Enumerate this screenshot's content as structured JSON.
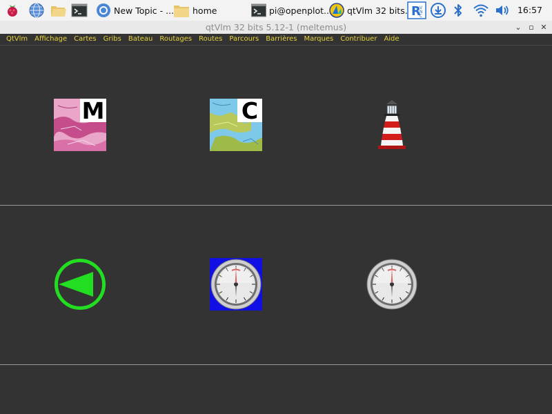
{
  "taskbar": {
    "tasks": [
      {
        "label": "New Topic - ..."
      },
      {
        "label": "home"
      },
      {
        "label": "pi@openplot..."
      },
      {
        "label": "qtVlm 32 bits..."
      }
    ],
    "clock": "16:57"
  },
  "window": {
    "title": "qtVlm 32 bits 5.12-1 (meltemus)",
    "buttons": {
      "minimize": "⌄",
      "maximize": "▫",
      "close": "✕"
    }
  },
  "menu": {
    "items": [
      "QtVlm",
      "Affichage",
      "Cartes",
      "Gribs",
      "Bateau",
      "Routages",
      "Routes",
      "Parcours",
      "Barrières",
      "Marques",
      "Contribuer",
      "Aide"
    ]
  },
  "toolbar": {
    "map_m_letter": "M",
    "map_c_letter": "C"
  },
  "colors": {
    "accent_menu_text": "#e8d23c",
    "background": "#333333",
    "compass_green": "#22dd22"
  }
}
